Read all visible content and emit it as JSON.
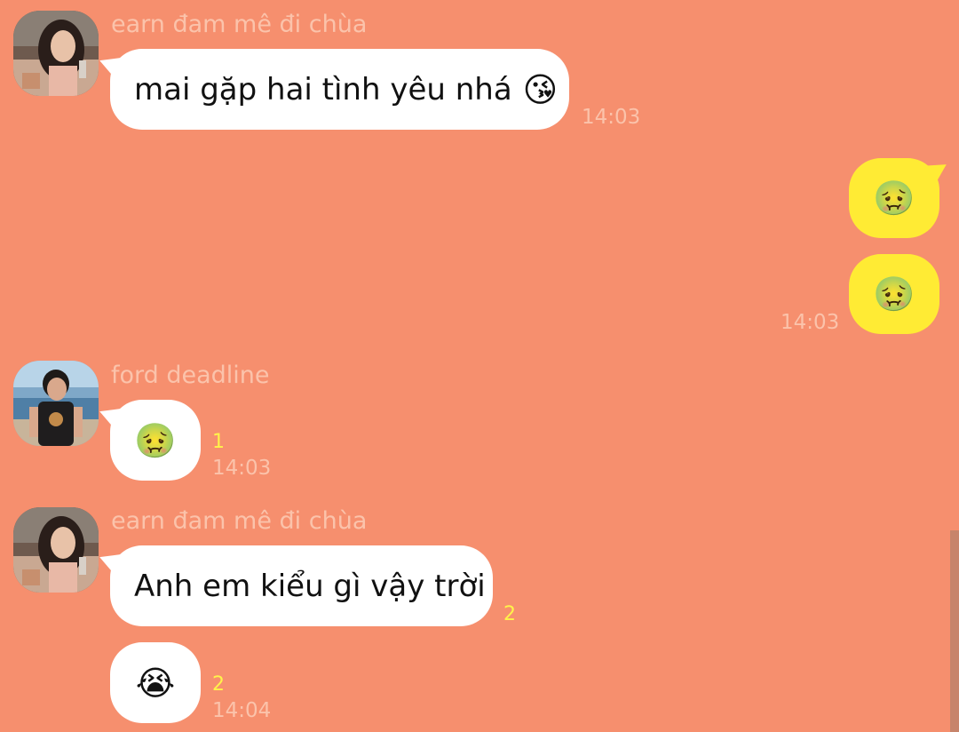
{
  "messages": [
    {
      "sender": "earn đam mê đi chùa",
      "text": "mai gặp hai tình yêu nhá",
      "emoji": "😘",
      "time": "14:03"
    },
    {
      "sender": "me",
      "emoji_1": "🤢",
      "emoji_2": "🤢",
      "time": "14:03"
    },
    {
      "sender": "ford deadline",
      "emoji": "🤢",
      "unread": "1",
      "time": "14:03"
    },
    {
      "sender": "earn đam mê đi chùa",
      "text": "Anh em kiểu gì vậy trời",
      "unread_1": "2",
      "emoji": "😭",
      "unread_2": "2",
      "time": "14:04"
    }
  ],
  "colors": {
    "background": "#F68F6E",
    "incoming_bubble": "#FFFFFF",
    "outgoing_bubble": "#FFEB34",
    "meta_text": "#FBC3AB",
    "unread_count": "#FFF34A"
  }
}
